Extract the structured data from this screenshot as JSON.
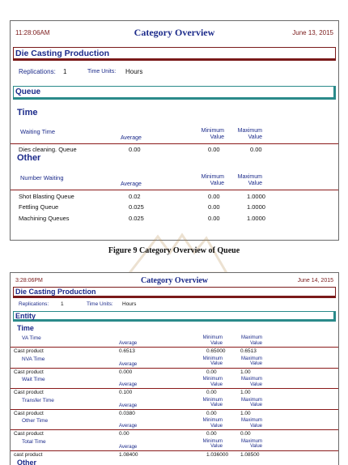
{
  "report1": {
    "time": "11:28:06AM",
    "title": "Category Overview",
    "date": "June 13, 2015",
    "production": "Die Casting Production",
    "replications_label": "Replications:",
    "replications_value": "1",
    "time_units_label": "Time Units:",
    "time_units_value": "Hours",
    "section": "Queue",
    "group_time": "Time",
    "waiting_time_header": "Waiting Time",
    "col_average": "Average",
    "col_minimum_1": "Minimum",
    "col_minimum_2": "Value",
    "col_maximum_1": "Maximum",
    "col_maximum_2": "Value",
    "time_rows": [
      {
        "name": "Dies cleaning. Queue",
        "avg": "0.00",
        "min": "0.00",
        "max": "0.00"
      }
    ],
    "group_other": "Other",
    "number_waiting_header": "Number Waiting",
    "other_rows": [
      {
        "name": "Shot Blasting Queue",
        "avg": "0.02",
        "min": "0.00",
        "max": "1.0000"
      },
      {
        "name": "Fettling Queue",
        "avg": "0.025",
        "min": "0.00",
        "max": "1.0000"
      },
      {
        "name": "Machining Queues",
        "avg": "0.025",
        "min": "0.00",
        "max": "1.0000"
      }
    ]
  },
  "caption": "Figure 9 Category Overview of Queue",
  "report2": {
    "time": "3:28:06PM",
    "title": "Category Overview",
    "date": "June 14, 2015",
    "production": "Die Casting Production",
    "replications_label": "Replications:",
    "replications_value": "1",
    "time_units_label": "Time Units:",
    "time_units_value": "Hours",
    "section": "Entity",
    "group_time": "Time",
    "col_average": "Average",
    "col_minimum_1": "Minimum",
    "col_minimum_2": "Value",
    "col_maximum_1": "Maximum",
    "col_maximum_2": "Value",
    "blocks": [
      {
        "header": "VA Time",
        "name": "Cast product",
        "avg": "0.6513",
        "min": "0.65000",
        "max": "0.6513"
      },
      {
        "header": "NVA Time",
        "name": "Cast product",
        "avg": "0.000",
        "min": "0.00",
        "max": "1.00"
      },
      {
        "header": "Wait Time",
        "name": "Cast product",
        "avg": "0.100",
        "min": "0.00",
        "max": "1.00"
      },
      {
        "header": "Transfer Time",
        "name": "Cast product",
        "avg": "0.0380",
        "min": "0.00",
        "max": "1.00"
      },
      {
        "header": "Other Time",
        "name": "Cast product",
        "avg": "0.00",
        "min": "0.00",
        "max": "0.00"
      },
      {
        "header": "Total Time",
        "name": "cast product",
        "avg": "1.08400",
        "min": "1.036000",
        "max": "1.08500"
      }
    ],
    "group_other": "Other"
  }
}
